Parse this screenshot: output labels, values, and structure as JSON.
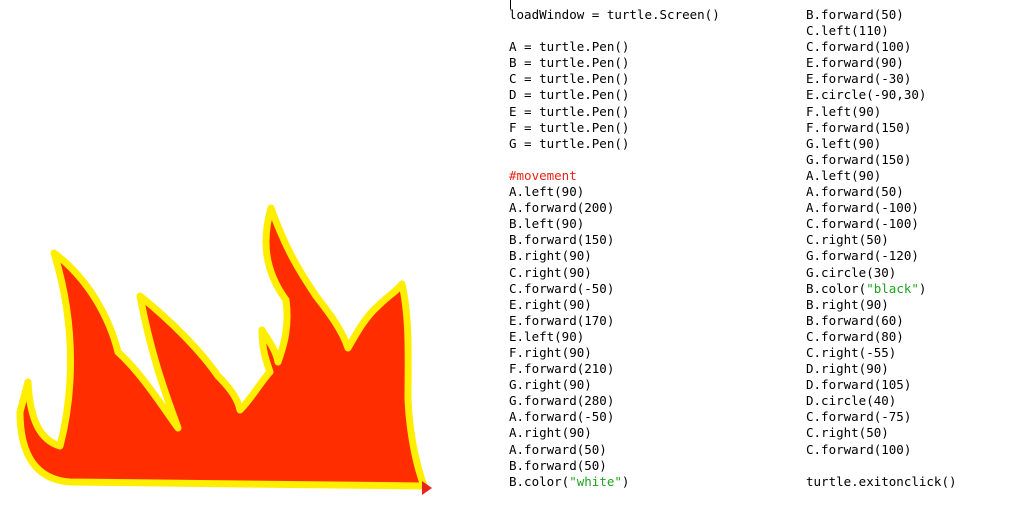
{
  "code": {
    "column_left": [
      {
        "text": "loadWindow = turtle.Screen()"
      },
      {
        "text": ""
      },
      {
        "text": "A = turtle.Pen()"
      },
      {
        "text": "B = turtle.Pen()"
      },
      {
        "text": "C = turtle.Pen()"
      },
      {
        "text": "D = turtle.Pen()"
      },
      {
        "text": "E = turtle.Pen()"
      },
      {
        "text": "F = turtle.Pen()"
      },
      {
        "text": "G = turtle.Pen()"
      },
      {
        "text": ""
      },
      {
        "text": "#movement",
        "kind": "comment"
      },
      {
        "text": "A.left(90)"
      },
      {
        "text": "A.forward(200)"
      },
      {
        "text": "B.left(90)"
      },
      {
        "text": "B.forward(150)"
      },
      {
        "text": "B.right(90)"
      },
      {
        "text": "C.right(90)"
      },
      {
        "text": "C.forward(-50)"
      },
      {
        "text": "E.right(90)"
      },
      {
        "text": "E.forward(170)"
      },
      {
        "text": "E.left(90)"
      },
      {
        "text": "F.right(90)"
      },
      {
        "text": "F.forward(210)"
      },
      {
        "text": "G.right(90)"
      },
      {
        "text": "G.forward(280)"
      },
      {
        "text": "A.forward(-50)"
      },
      {
        "text": "A.right(90)"
      },
      {
        "text": "A.forward(50)"
      },
      {
        "text": "B.forward(50)"
      },
      {
        "text": "B.color(",
        "string": "\"white\"",
        "suffix": ")"
      }
    ],
    "column_right": [
      {
        "text": "B.forward(50)"
      },
      {
        "text": "C.left(110)"
      },
      {
        "text": "C.forward(100)"
      },
      {
        "text": "E.forward(90)"
      },
      {
        "text": "E.forward(-30)"
      },
      {
        "text": "E.circle(-90,30)"
      },
      {
        "text": "F.left(90)"
      },
      {
        "text": "F.forward(150)"
      },
      {
        "text": "G.left(90)"
      },
      {
        "text": "G.forward(150)"
      },
      {
        "text": "A.left(90)"
      },
      {
        "text": "A.forward(50)"
      },
      {
        "text": "A.forward(-100)"
      },
      {
        "text": "C.forward(-100)"
      },
      {
        "text": "C.right(50)"
      },
      {
        "text": "G.forward(-120)"
      },
      {
        "text": "G.circle(30)"
      },
      {
        "text": "B.color(",
        "string": "\"black\"",
        "suffix": ")"
      },
      {
        "text": "B.right(90)"
      },
      {
        "text": "B.forward(60)"
      },
      {
        "text": "C.forward(80)"
      },
      {
        "text": "C.right(-55)"
      },
      {
        "text": "D.right(90)"
      },
      {
        "text": "D.forward(105)"
      },
      {
        "text": "D.circle(40)"
      },
      {
        "text": "C.forward(-75)"
      },
      {
        "text": "C.right(50)"
      },
      {
        "text": "C.forward(100)"
      },
      {
        "text": ""
      },
      {
        "text": "turtle.exitonclick()"
      }
    ]
  },
  "colors": {
    "flame_fill": "#ff2d00",
    "flame_outline": "#ffee00",
    "comment": "#e8251a",
    "string": "#1fa31f",
    "code_text": "#000000",
    "turtle_cursor": "#e8251a"
  }
}
